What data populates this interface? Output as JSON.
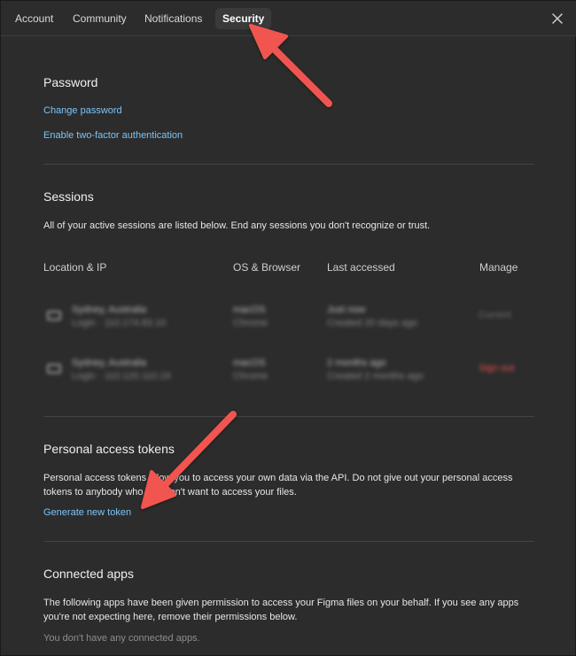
{
  "tabs": [
    {
      "label": "Account"
    },
    {
      "label": "Community"
    },
    {
      "label": "Notifications"
    },
    {
      "label": "Security"
    }
  ],
  "password": {
    "heading": "Password",
    "change_link": "Change password",
    "twofa_link": "Enable two-factor authentication"
  },
  "sessions": {
    "heading": "Sessions",
    "description": "All of your active sessions are listed below. End any sessions you don't recognize or trust.",
    "columns": [
      "Location & IP",
      "OS & Browser",
      "Last accessed",
      "Manage"
    ],
    "rows": [
      {
        "location": "Sydney, Australia",
        "login": "Login · 110.174.83.10",
        "os": "macOS",
        "browser": "Chrome",
        "last": "Just now",
        "created": "Created 20 days ago",
        "manage": "Current"
      },
      {
        "location": "Sydney, Australia",
        "login": "Login · 110.120.110.19",
        "os": "macOS",
        "browser": "Chrome",
        "last": "2 months ago",
        "created": "Created 2 months ago",
        "manage": "Sign out"
      }
    ]
  },
  "tokens": {
    "heading": "Personal access tokens",
    "description": "Personal access tokens allow you to access your own data via the API. Do not give out your personal access tokens to anybody who you don't want to access your files.",
    "generate_link": "Generate new token"
  },
  "connected": {
    "heading": "Connected apps",
    "description": "The following apps have been given permission to access your Figma files on your behalf. If you see any apps you're not expecting here, remove their permissions below.",
    "empty": "You don't have any connected apps."
  },
  "colors": {
    "link": "#7cc4fa",
    "arrow": "#f0554f",
    "sign_out": "#e5534b",
    "background": "#2c2c2c"
  },
  "icons": [
    "close-icon",
    "device-icon",
    "annotation-arrow"
  ]
}
